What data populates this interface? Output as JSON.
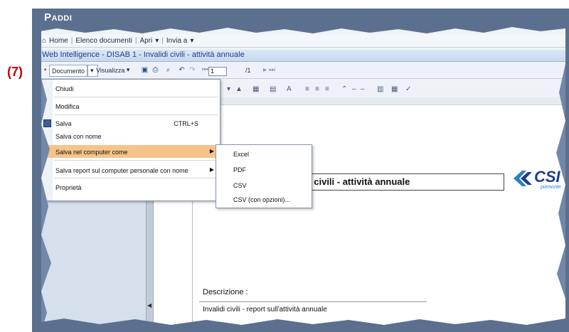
{
  "brand": {
    "title_first": "P",
    "title_rest": "ADDI"
  },
  "step_label": "(7)",
  "topnav": {
    "home": "Home",
    "items": [
      "Elenco documenti",
      "Apri",
      "Invia a"
    ]
  },
  "window_title": "Web Intelligence - DISAB 1 - Invalidi civili - attività annuale",
  "toolbar": {
    "documento": "Documento",
    "visualizza": "Visualizza",
    "page_value": "1",
    "page_total": "/1"
  },
  "menu": {
    "items": [
      {
        "label": "Chiudi"
      },
      {
        "label": "Modifica"
      },
      {
        "label": "Salva",
        "shortcut": "CTRL+S"
      },
      {
        "label": "Salva con nome"
      },
      {
        "label": "Salva nel computer come"
      },
      {
        "label": "Salva report sul computer personale con nome"
      },
      {
        "label": "Proprietà"
      }
    ]
  },
  "submenu": {
    "items": [
      "Excel",
      "PDF",
      "CSV",
      "CSV (con opzioni)..."
    ]
  },
  "report": {
    "title": "DISAB 1 - Invalidi civili - attività annuale",
    "logo_text": "CSI",
    "logo_sub": "piemonte",
    "description_label": "Descrizione :",
    "description_value": "Invalidi civili - report sull'attività annuale"
  },
  "colors": {
    "frame": "#5b6f8e",
    "highlight": "#f6c48a",
    "step": "#c00000",
    "logo": "#1c3f8e"
  }
}
